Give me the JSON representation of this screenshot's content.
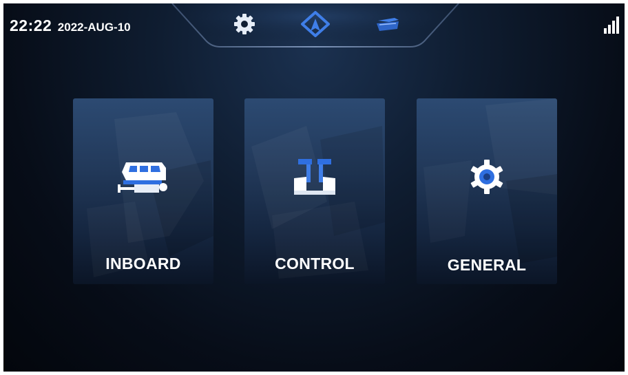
{
  "status_bar": {
    "time": "22:22",
    "date": "2022-AUG-10"
  },
  "top_nav": {
    "items": [
      {
        "icon": "gear-icon",
        "active": false
      },
      {
        "icon": "navigation-arrow-icon",
        "active": true
      },
      {
        "icon": "boat-icon",
        "active": false
      }
    ]
  },
  "signal": {
    "icon": "signal-strength-icon",
    "level": 4,
    "max_level": 4
  },
  "menu": {
    "cards": [
      {
        "label": "INBOARD",
        "icon": "inboard-engine-icon"
      },
      {
        "label": "CONTROL",
        "icon": "throttle-control-icon"
      },
      {
        "label": "GENERAL",
        "icon": "gear-icon"
      }
    ]
  },
  "colors": {
    "background": "#0b1526",
    "card": "#22395a",
    "accent_blue": "#2f6fe0",
    "text": "#ffffff"
  }
}
